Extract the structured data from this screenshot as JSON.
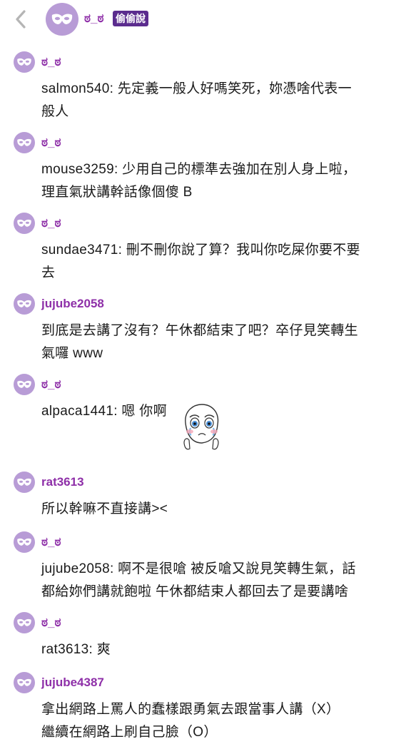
{
  "header": {
    "name": "ಠ_ಠ",
    "badge": "偷偷說",
    "back_icon": "chevron-left-icon",
    "avatar_icon": "mask-icon"
  },
  "colors": {
    "accent_name": "#8e2fa8",
    "avatar_bg": "#b89cd6",
    "badge_bg": "#5b2c8e"
  },
  "comments": [
    {
      "name": "ಠ_ಠ",
      "lines": [
        "salmon540: 先定義一般人好嗎笑死，妳憑啥代表一",
        "般人"
      ]
    },
    {
      "name": "ಠ_ಠ",
      "lines": [
        "mouse3259: 少用自己的標準去強加在別人身上啦，",
        "理直氣狀講幹話像個傻 B"
      ]
    },
    {
      "name": "ಠ_ಠ",
      "lines": [
        "sundae3471: 刪不刪你說了算？我叫你吃屎你要不要",
        "去"
      ]
    },
    {
      "name": "jujube2058",
      "lines": [
        "到底是去講了沒有？午休都結束了吧？卒仔見笑轉生",
        "氣囉 www"
      ]
    },
    {
      "name": "ಠ_ಠ",
      "lines": [
        "alpaca1441: 嗯 你啊"
      ],
      "sticker": "teary-face-sticker"
    },
    {
      "name": "rat3613",
      "lines": [
        "所以幹嘛不直接講><"
      ]
    },
    {
      "name": "ಠ_ಠ",
      "lines": [
        "jujube2058: 啊不是很嗆 被反嗆又說見笑轉生氣，話",
        "都給妳們講就飽啦 午休都結束人都回去了是要講啥"
      ]
    },
    {
      "name": "ಠ_ಠ",
      "lines": [
        "rat3613: 爽"
      ]
    },
    {
      "name": "jujube4387",
      "lines": [
        "拿出網路上罵人的蠢樣跟勇氣去跟當事人講（X）",
        "繼續在網路上刷自己臉（O）"
      ]
    }
  ]
}
